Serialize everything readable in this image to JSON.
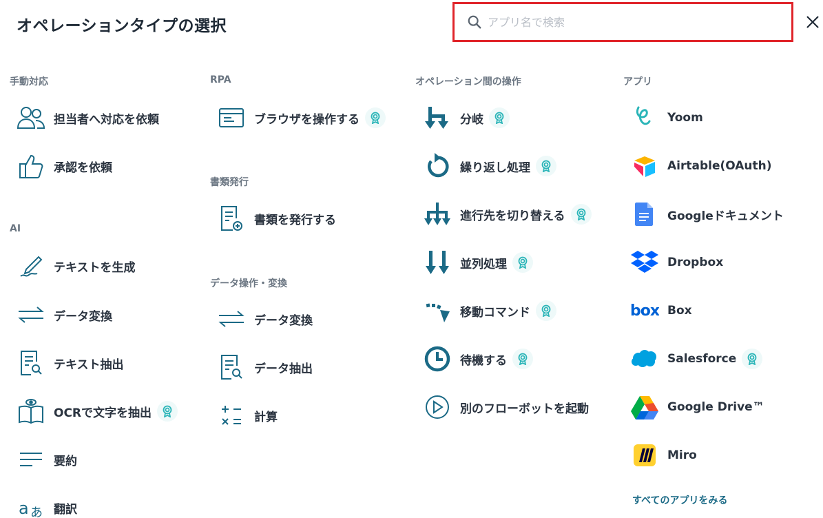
{
  "header": {
    "title": "オペレーションタイプの選択",
    "search_placeholder": "アプリ名で検索"
  },
  "columns": {
    "manual": {
      "section": "手動対応",
      "items": [
        "担当者へ対応を依頼",
        "承認を依頼"
      ]
    },
    "ai": {
      "section": "AI",
      "items": [
        "テキストを生成",
        "データ変換",
        "テキスト抽出",
        "OCRで文字を抽出",
        "要約",
        "翻訳"
      ]
    },
    "rpa": {
      "section": "RPA",
      "items": [
        "ブラウザを操作する"
      ]
    },
    "docs": {
      "section": "書類発行",
      "items": [
        "書類を発行する"
      ]
    },
    "data_ops": {
      "section": "データ操作・変換",
      "items": [
        "データ変換",
        "データ抽出",
        "計算"
      ]
    },
    "flow": {
      "section": "オペレーション間の操作",
      "items": [
        "分岐",
        "繰り返し処理",
        "進行先を切り替える",
        "並列処理",
        "移動コマンド",
        "待機する",
        "別のフローボットを起動"
      ]
    },
    "apps": {
      "section": "アプリ",
      "items": [
        "Yoom",
        "Airtable(OAuth)",
        "Googleドキュメント",
        "Dropbox",
        "Box",
        "Salesforce",
        "Google Drive™",
        "Miro"
      ],
      "see_all": "すべてのアプリをみる"
    }
  },
  "icons": {
    "premium_badge": "award-icon",
    "accent_color": "#1b6a86",
    "badge_color": "#2bb5b8"
  }
}
